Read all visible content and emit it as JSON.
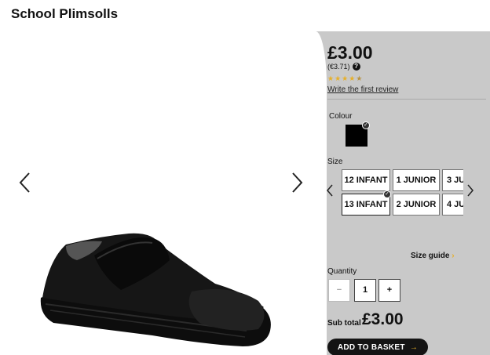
{
  "page": {
    "title": "School Plimsolls"
  },
  "product": {
    "price": "£3.00",
    "price_eur": "(€3.71)",
    "rating": 4.5,
    "rating_max": 5,
    "review_link": "Write the first review"
  },
  "colour": {
    "label": "Colour",
    "selected_color": "#000000"
  },
  "size": {
    "label": "Size",
    "options": [
      "12 INFANT",
      "1 JUNIOR",
      "3 JU",
      "13 INFANT",
      "2 JUNIOR",
      "4 JU"
    ],
    "selected": "13 INFANT"
  },
  "size_guide": {
    "label": "Size guide"
  },
  "quantity": {
    "label": "Quantity",
    "minus": "−",
    "value": "1",
    "plus": "+"
  },
  "subtotal": {
    "label": "Sub total",
    "value": "£3.00"
  },
  "basket": {
    "label": "ADD TO BASKET"
  },
  "colors": {
    "panel": "#c9c9c9",
    "accent": "#e7b02a",
    "button": "#141414"
  },
  "icons": [
    "chevron-left-icon",
    "chevron-right-icon",
    "help-icon",
    "star-icon",
    "check-icon",
    "arrow-right-icon"
  ]
}
